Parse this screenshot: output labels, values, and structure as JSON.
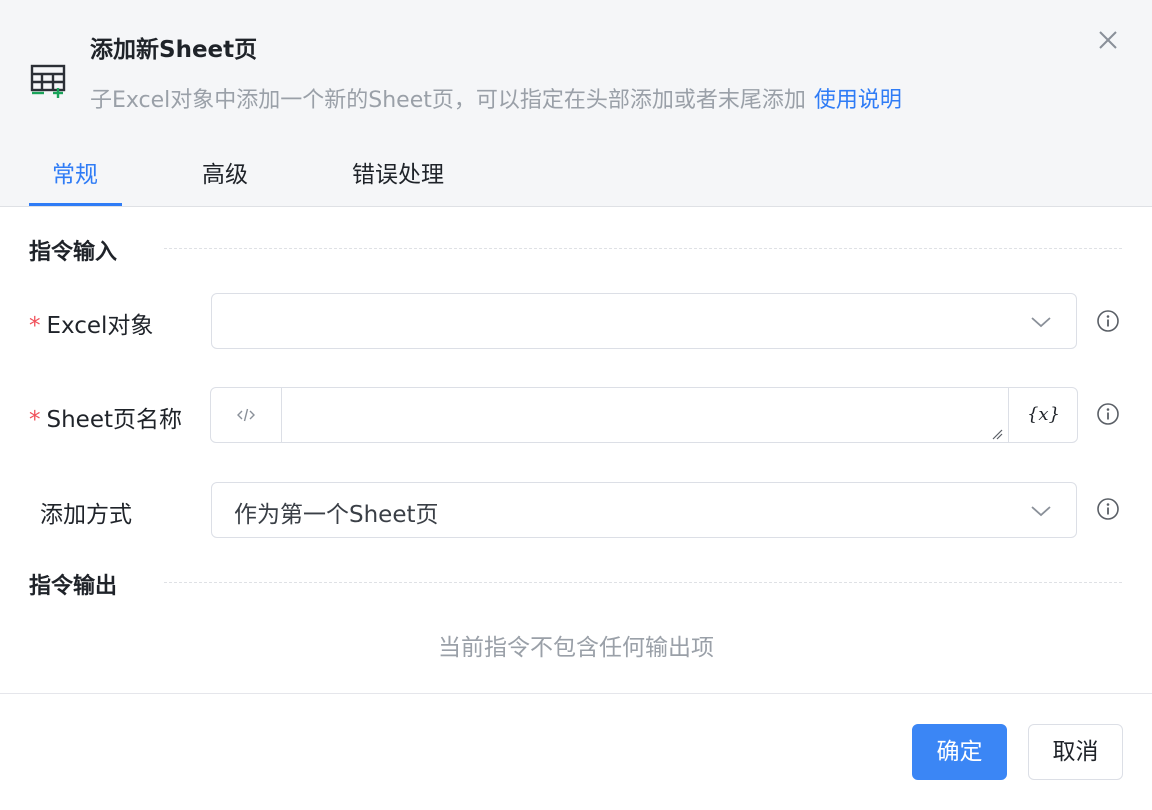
{
  "dialog": {
    "title": "添加新Sheet页",
    "description": "子Excel对象中添加一个新的Sheet页，可以指定在头部添加或者末尾添加",
    "help_link": "使用说明",
    "icon": "excel-sheet-add-icon"
  },
  "tabs": [
    {
      "label": "常规",
      "active": true
    },
    {
      "label": "高级",
      "active": false
    },
    {
      "label": "错误处理",
      "active": false
    }
  ],
  "input_section": {
    "title": "指令输入",
    "fields": [
      {
        "label": "Excel对象",
        "required": true,
        "type": "select",
        "value": ""
      },
      {
        "label": "Sheet页名称",
        "required": true,
        "type": "text",
        "value": "",
        "var_button": "{x}"
      },
      {
        "label": "添加方式",
        "required": false,
        "type": "select",
        "value": "作为第一个Sheet页"
      }
    ]
  },
  "output_section": {
    "title": "指令输出",
    "empty_text": "当前指令不包含任何输出项"
  },
  "footer": {
    "confirm_label": "确定",
    "cancel_label": "取消"
  },
  "colors": {
    "accent": "#2f7cf6",
    "primary_button": "#3b86f5",
    "required": "#f0505a",
    "header_bg": "#f5f6f8"
  }
}
